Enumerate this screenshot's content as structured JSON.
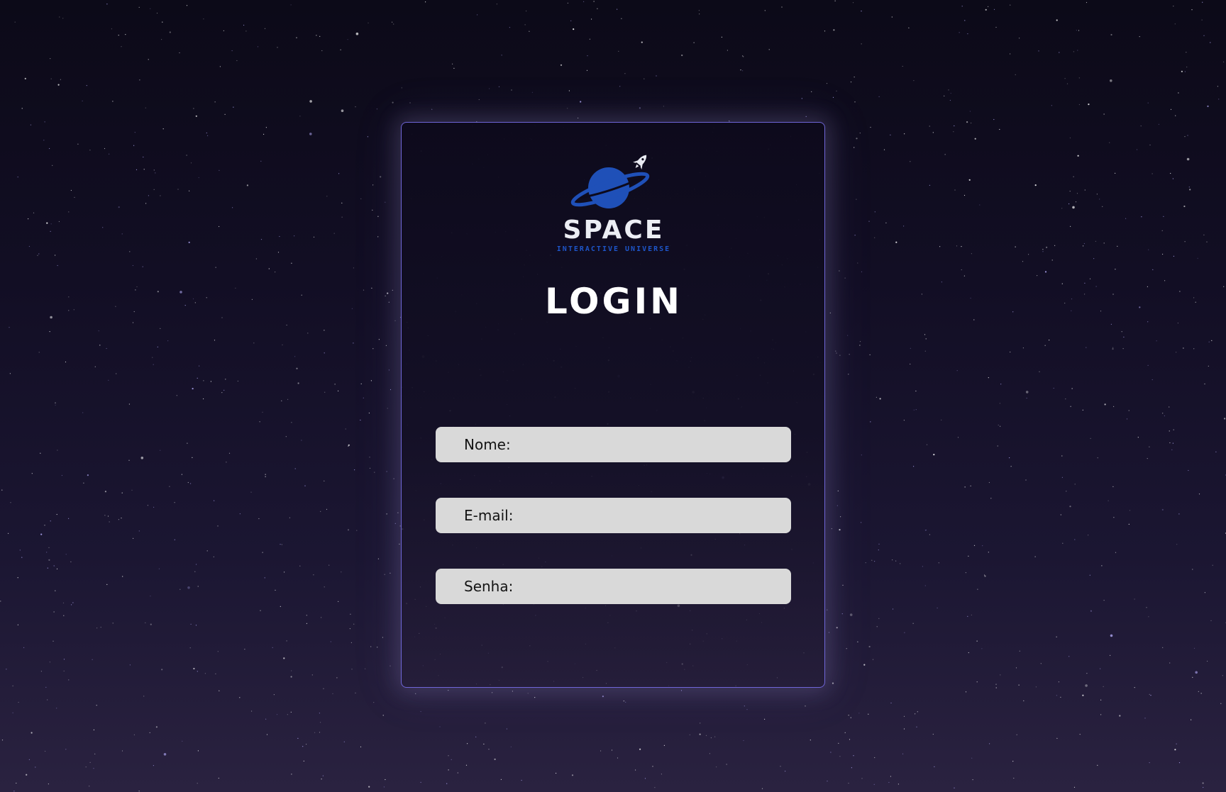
{
  "brand": {
    "name": "SPACE",
    "tagline": "INTERACTIVE UNIVERSE",
    "icon": "planet-rocket-icon",
    "accent_color": "#1e55c8"
  },
  "login": {
    "title": "LOGIN"
  },
  "form": {
    "nome_placeholder": "Nome:",
    "email_placeholder": "E-mail:",
    "senha_placeholder": "Senha:"
  },
  "theme": {
    "card_border": "#6f66d8",
    "field_bg": "#d9d9d9"
  }
}
